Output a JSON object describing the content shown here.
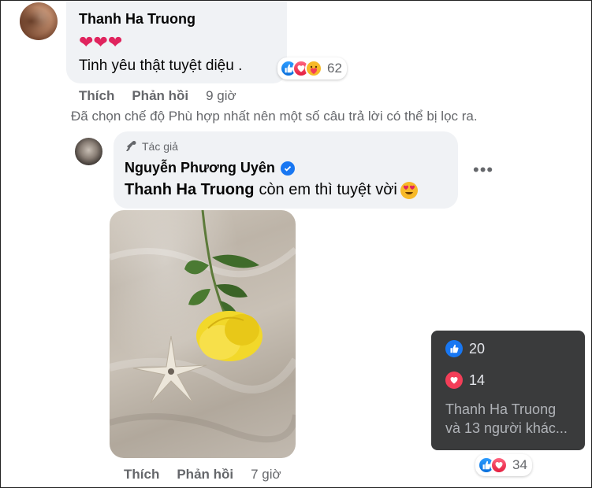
{
  "comment": {
    "author": "Thanh Ha Truong",
    "hearts": "❤❤❤",
    "text": "Tinh yêu thật tuyệt diệu .",
    "reaction_count": "62",
    "actions": {
      "like": "Thích",
      "reply": "Phản hồi",
      "time": "9 giờ"
    }
  },
  "filter_note": "Đã chọn chế độ Phù hợp nhất nên một số câu trả lời có thể bị lọc ra.",
  "reply": {
    "author_tag": "Tác giả",
    "author": "Nguyễn Phương Uyên",
    "mention": "Thanh Ha Truong",
    "text": "còn em thì tuyệt vời",
    "more": "•••",
    "reaction_count": "34",
    "actions": {
      "like": "Thích",
      "reply": "Phản hồi",
      "time": "7 giờ"
    }
  },
  "tooltip": {
    "like_count": "20",
    "love_count": "14",
    "names_line1": "Thanh Ha Truong",
    "names_line2": "và 13 người khác..."
  },
  "colors": {
    "like": "#1877f2",
    "love": "#f33e58",
    "care": "#f7b928",
    "tooltip_bg": "#3a3b3c"
  }
}
